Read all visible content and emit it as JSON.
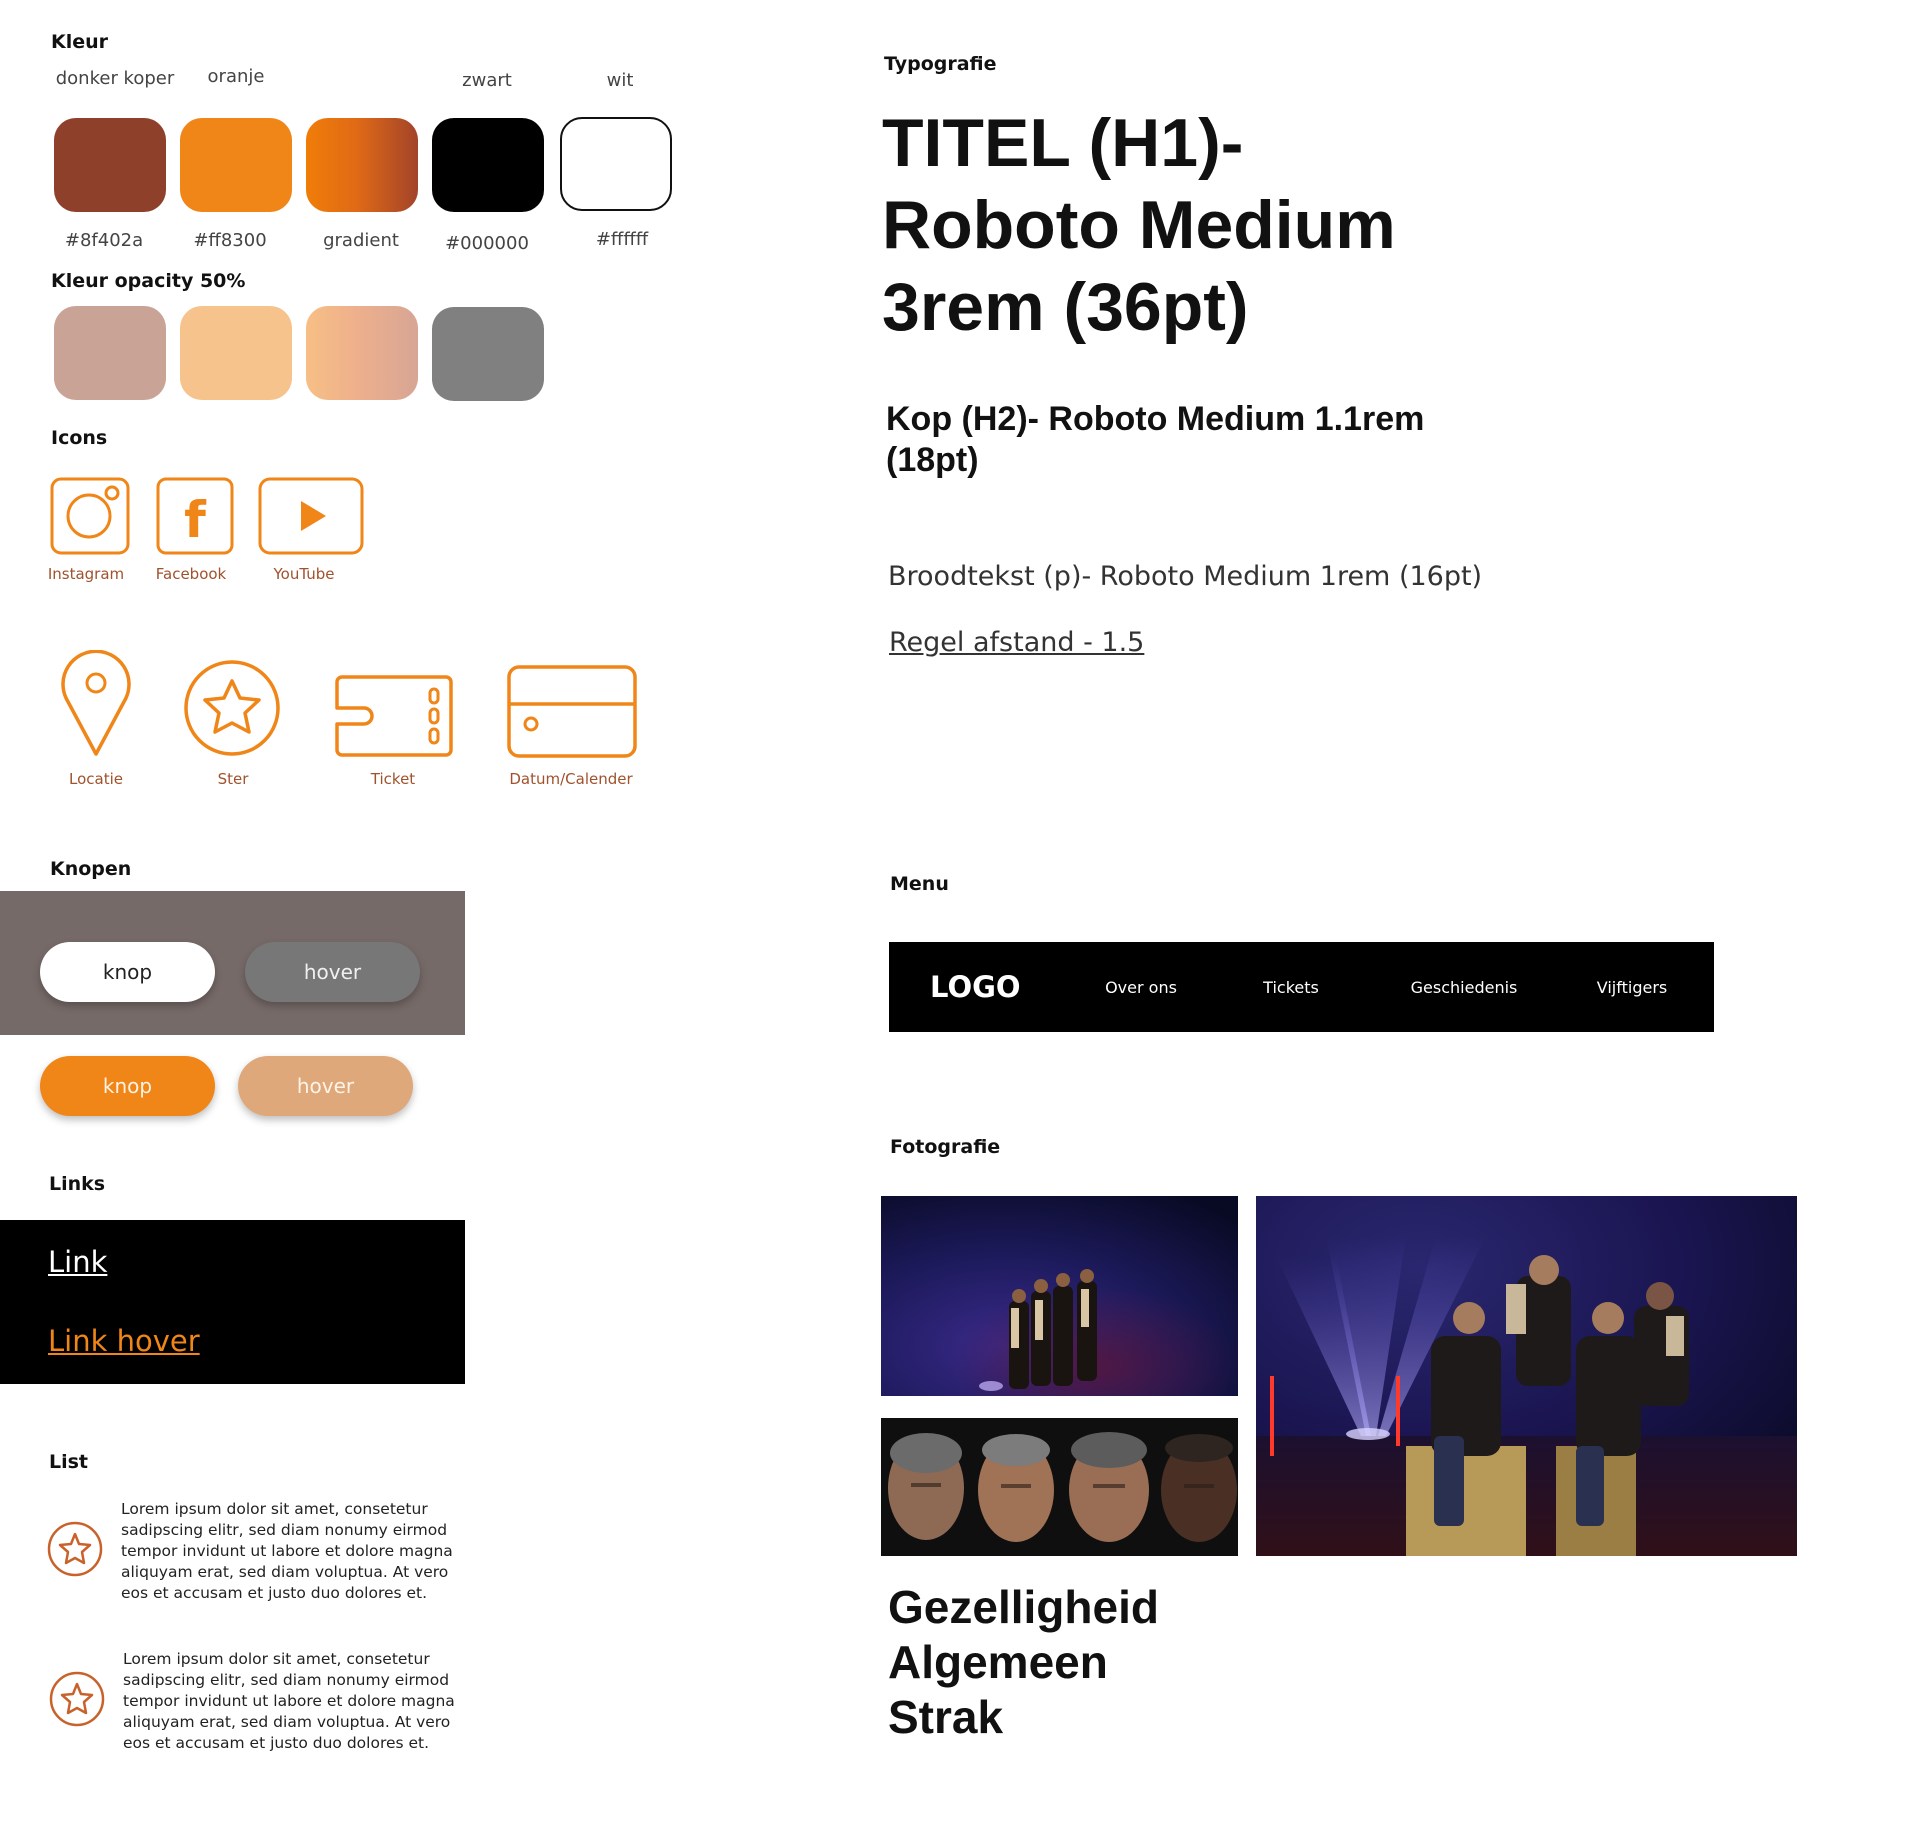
{
  "colors": {
    "title": "Kleur",
    "swatches": [
      {
        "name": "donker koper",
        "code": "#8f402a",
        "color": "#8f402a"
      },
      {
        "name": "oranje",
        "code": "#ff8300",
        "color": "#f08518"
      },
      {
        "name": "",
        "code": "gradient",
        "color": "gradient"
      },
      {
        "name": "zwart",
        "code": "#000000",
        "color": "#000000"
      },
      {
        "name": "wit",
        "code": "#ffffff",
        "color": "#ffffff"
      }
    ],
    "opacity_title": "Kleur opacity 50%",
    "opacity_swatches": [
      "#c9a396",
      "#f7c38c",
      "gradient",
      "#808080"
    ]
  },
  "icons": {
    "title": "Icons",
    "social": [
      {
        "label": "Instagram",
        "icon": "instagram-icon"
      },
      {
        "label": "Facebook",
        "icon": "facebook-icon"
      },
      {
        "label": "YouTube",
        "icon": "youtube-icon"
      }
    ],
    "general": [
      {
        "label": "Locatie",
        "icon": "location-pin-icon"
      },
      {
        "label": "Ster",
        "icon": "star-icon"
      },
      {
        "label": "Ticket",
        "icon": "ticket-icon"
      },
      {
        "label": "Datum/Calender",
        "icon": "calendar-icon"
      }
    ],
    "accent_color": "#f08518",
    "label_color": "#a0522d"
  },
  "buttons": {
    "title": "Knopen",
    "dark_bg": {
      "knop": "knop",
      "hover": "hover"
    },
    "light_bg": {
      "knop": "knop",
      "hover": "hover"
    }
  },
  "links": {
    "title": "Links",
    "link": "Link",
    "link_hover": "Link hover"
  },
  "list": {
    "title": "List",
    "items": [
      {
        "lines": [
          "Lorem ipsum dolor sit amet, consetetur",
          "sadipscing elitr, sed diam nonumy eirmod",
          "tempor invidunt ut labore et dolore magna",
          "aliquyam erat, sed diam voluptua. At vero",
          "eos et accusam et justo duo dolores et."
        ]
      },
      {
        "lines": [
          "Lorem ipsum dolor sit amet, consetetur",
          "sadipscing elitr, sed diam nonumy eirmod",
          "tempor invidunt ut labore et dolore magna",
          "aliquyam erat, sed diam voluptua. At vero",
          "eos et accusam et justo duo dolores et."
        ]
      }
    ]
  },
  "typography": {
    "title": "Typografie",
    "h1_lines": [
      "TITEL (H1)-",
      "Roboto Medium",
      "3rem (36pt)"
    ],
    "h2_lines": [
      "Kop (H2)- Roboto Medium 1.1rem",
      "(18pt)"
    ],
    "body": "Broodtekst (p)- Roboto Medium 1rem (16pt)",
    "line_height": "Regel afstand -  1.5"
  },
  "menu": {
    "title": "Menu",
    "logo": "LOGO",
    "items": [
      "Over ons",
      "Tickets",
      "Geschiedenis",
      "Vijftigers"
    ]
  },
  "photography": {
    "title": "Fotografie",
    "photos": [
      "group-on-stage-small",
      "portraits-row",
      "group-on-stage-large"
    ],
    "keywords": [
      "Gezelligheid",
      "Algemeen",
      "Strak"
    ]
  }
}
